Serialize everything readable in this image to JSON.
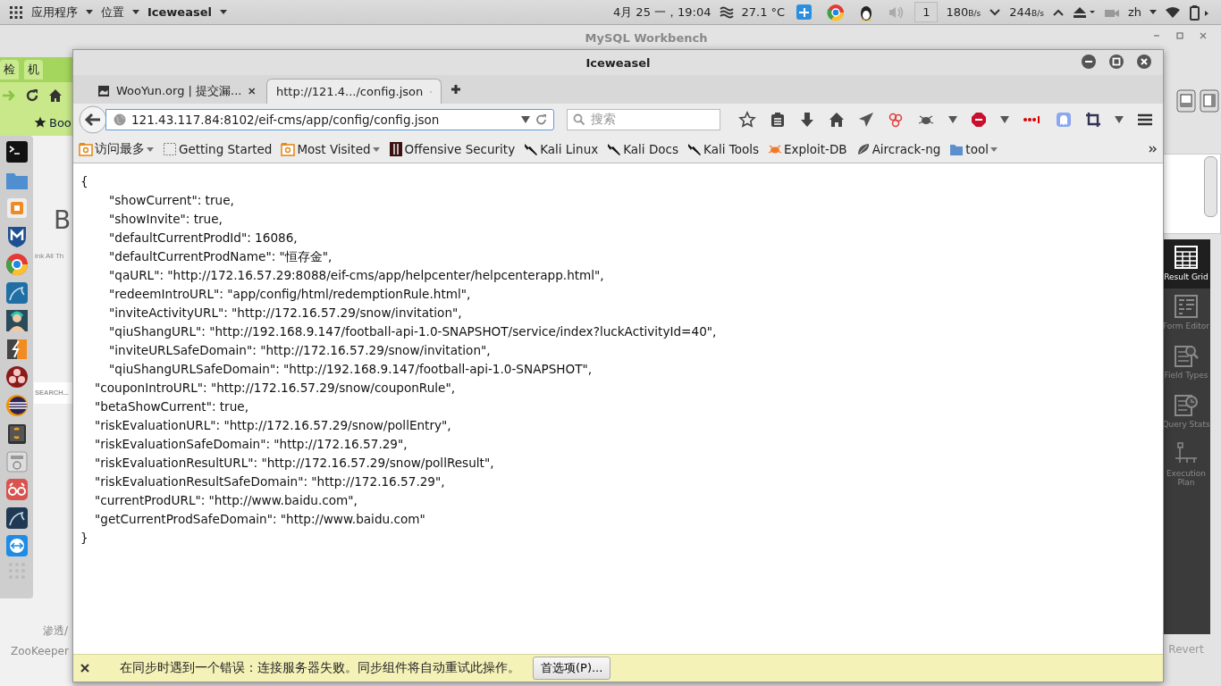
{
  "top_panel": {
    "apps_menu": "应用程序",
    "places_menu": "位置",
    "app_menu": "Iceweasel",
    "clock": "4月 25 一，19:04",
    "weather": "27.1 °C",
    "workspace": "1",
    "download": "180",
    "download_unit": "B/s",
    "upload": "244",
    "upload_unit": "B/s",
    "language": "zh"
  },
  "background_window": {
    "title": "MySQL Workbench",
    "sidebar_items": [
      {
        "label": "Result Grid",
        "kind": "grid",
        "selected": true
      },
      {
        "label": "Form Editor",
        "kind": "form",
        "selected": false
      },
      {
        "label": "Field Types",
        "kind": "types",
        "selected": false
      },
      {
        "label": "Query Stats",
        "kind": "stats",
        "selected": false
      },
      {
        "label": "Execution Plan",
        "kind": "plan",
        "selected": false
      }
    ],
    "revert_button": "Revert"
  },
  "background_browser": {
    "tabs": [
      "检",
      "机"
    ],
    "bookmark": "Boo",
    "heading": "B",
    "tagline": "ink All Th",
    "search_placeholder": "SEARCH...",
    "footer_lines": [
      "渗透/",
      "ZooKeeper"
    ]
  },
  "browser": {
    "title": "Iceweasel",
    "tabs": [
      {
        "title": "WooYun.org | 提交漏...",
        "selected": false
      },
      {
        "title": "http://121.4.../config.json",
        "selected": true
      }
    ],
    "url": "121.43.117.84:8102/eif-cms/app/config/config.json",
    "search_placeholder": "搜索",
    "bookmarks": [
      {
        "label": "访问最多",
        "kind": "menu"
      },
      {
        "label": "Getting Started",
        "kind": "page"
      },
      {
        "label": "Most Visited",
        "kind": "menu"
      },
      {
        "label": "Offensive Security",
        "kind": "site"
      },
      {
        "label": "Kali Linux",
        "kind": "tool"
      },
      {
        "label": "Kali Docs",
        "kind": "tool"
      },
      {
        "label": "Kali Tools",
        "kind": "tool"
      },
      {
        "label": "Exploit-DB",
        "kind": "bug"
      },
      {
        "label": "Aircrack-ng",
        "kind": "dish"
      },
      {
        "label": "tool",
        "kind": "folder"
      }
    ],
    "content": "{\n\t\t\"showCurrent\": true,\n\t\t\"showInvite\": true,\n\t\t\"defaultCurrentProdId\": 16086,\n\t\t\"defaultCurrentProdName\": \"恒存金\",\n\t\t\"qaURL\": \"http://172.16.57.29:8088/eif-cms/app/helpcenter/helpcenterapp.html\",\n\t\t\"redeemIntroURL\": \"app/config/html/redemptionRule.html\",\n\t\t\"inviteActivityURL\": \"http://172.16.57.29/snow/invitation\",\n\t\t\"qiuShangURL\": \"http://192.168.9.147/football-api-1.0-SNAPSHOT/service/index?luckActivityId=40\",\n\t\t\"inviteURLSafeDomain\": \"http://172.16.57.29/snow/invitation\",\n\t\t\"qiuShangURLSafeDomain\": \"http://192.168.9.147/football-api-1.0-SNAPSHOT\",\n\t\"couponIntroURL\": \"http://172.16.57.29/snow/couponRule\",\n\t\"betaShowCurrent\": true,\n\t\"riskEvaluationURL\": \"http://172.16.57.29/snow/pollEntry\",\n\t\"riskEvaluationSafeDomain\": \"http://172.16.57.29\",\n\t\"riskEvaluationResultURL\": \"http://172.16.57.29/snow/pollResult\",\n\t\"riskEvaluationResultSafeDomain\": \"http://172.16.57.29\",\n\t\"currentProdURL\": \"http://www.baidu.com\",\n\t\"getCurrentProdSafeDomain\": \"http://www.baidu.com\"\n}",
    "notification": {
      "message": "在同步时遇到一个错误：连接服务器失败。同步组件将自动重试此操作。",
      "button": "首选项(P)..."
    }
  }
}
